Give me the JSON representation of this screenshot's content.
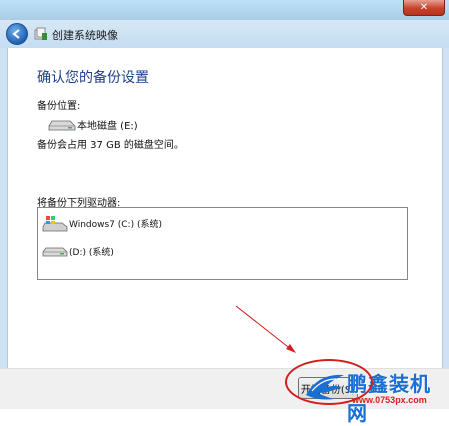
{
  "window": {
    "close_label": "✕",
    "title": "创建系统映像"
  },
  "page": {
    "heading": "确认您的备份设置",
    "location_label": "备份位置:",
    "target_drive": "本地磁盘 (E:)",
    "space_info": "备份会占用 37 GB 的磁盘空间。",
    "drives_label": "将备份下列驱动器:",
    "drives": [
      {
        "label": "Windows7 (C:) (系统)",
        "icon": "windows-drive-icon"
      },
      {
        "label": "(D:) (系统)",
        "icon": "hard-drive-icon"
      }
    ]
  },
  "footer": {
    "start_button": "开始备份(S)"
  },
  "watermark": {
    "name": "鹏鑫装机网",
    "url": "www.0753px.com"
  }
}
